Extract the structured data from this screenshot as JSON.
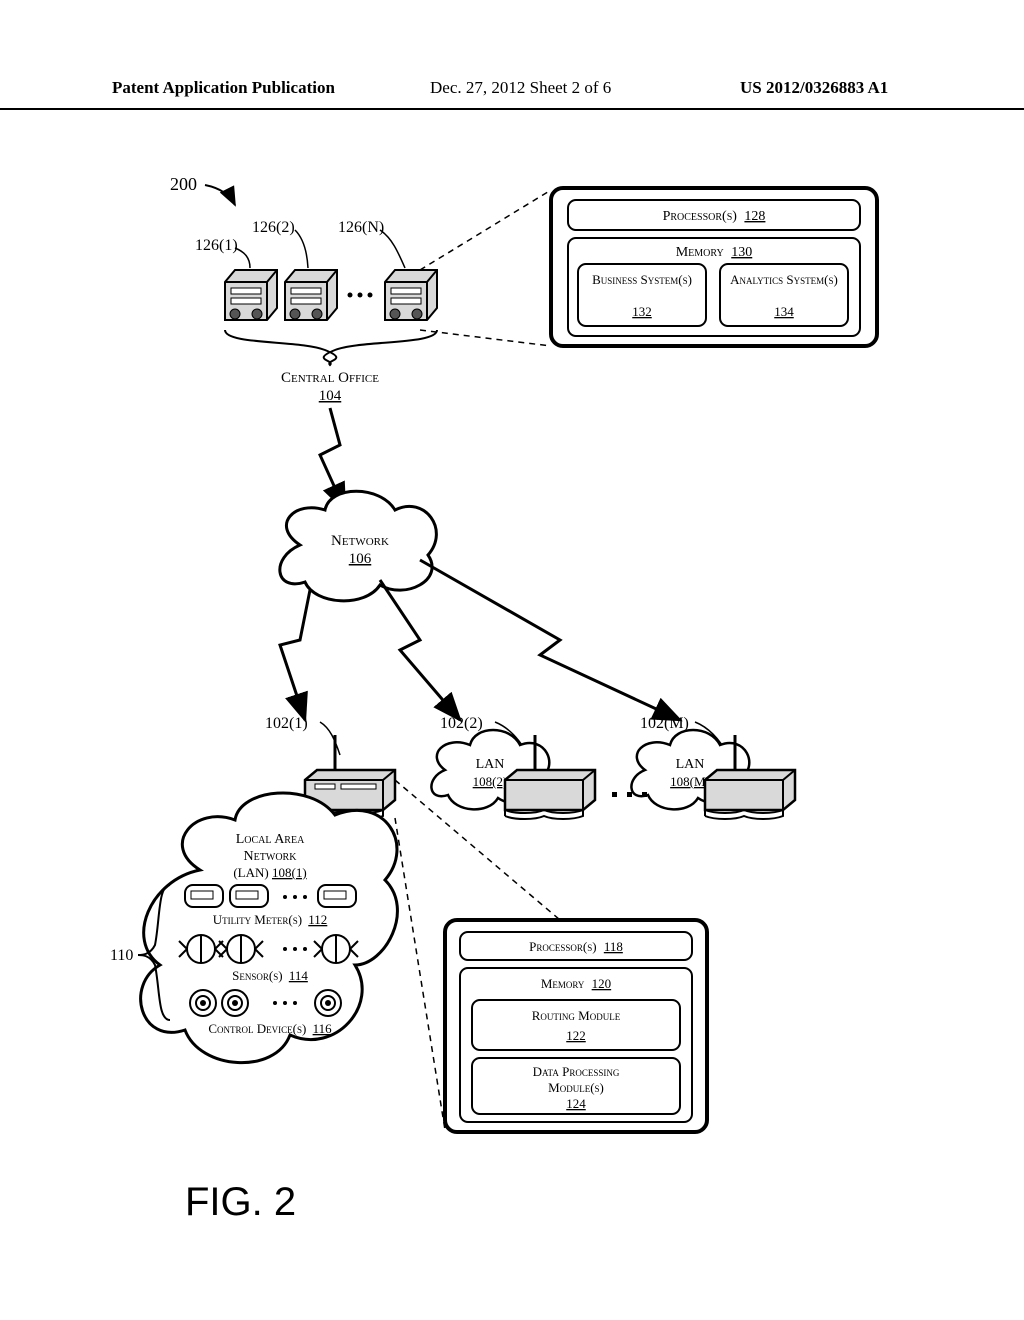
{
  "header": {
    "left": "Patent Application Publication",
    "center": "Dec. 27, 2012  Sheet 2 of 6",
    "right": "US 2012/0326883 A1"
  },
  "figure_label": "FIG. 2",
  "ref_200": "200",
  "servers": {
    "label_126_1": "126(1)",
    "label_126_2": "126(2)",
    "label_126_N": "126(N)"
  },
  "central_office": {
    "label": "Central Office",
    "num": "104"
  },
  "network": {
    "label": "Network",
    "num": "106"
  },
  "lan1": {
    "label": "Local Area Network (LAN)",
    "num": "108(1)"
  },
  "lan2": {
    "label": "LAN",
    "num": "108(2)"
  },
  "lanM": {
    "label": "LAN",
    "num": "108(M)"
  },
  "network_nodes": {
    "n1": "102(1)",
    "n2": "102(2)",
    "nM": "102(M)"
  },
  "devices_group": "110",
  "utility_meters": {
    "label": "Utility Meter(s)",
    "num": "112"
  },
  "sensors": {
    "label": "Sensor(s)",
    "num": "114"
  },
  "control_devices": {
    "label": "Control Device(s)",
    "num": "116"
  },
  "node_detail": {
    "processors": {
      "label": "Processor(s)",
      "num": "118"
    },
    "memory": {
      "label": "Memory",
      "num": "120"
    },
    "routing": {
      "label": "Routing Module",
      "num": "122"
    },
    "dataproc": {
      "label": "Data Processing Module(s)",
      "num": "124"
    }
  },
  "server_detail": {
    "processors": {
      "label": "Processor(s)",
      "num": "128"
    },
    "memory": {
      "label": "Memory",
      "num": "130"
    },
    "business": {
      "label": "Business System(s)",
      "num": "132"
    },
    "analytics": {
      "label": "Analytics System(s)",
      "num": "134"
    }
  }
}
